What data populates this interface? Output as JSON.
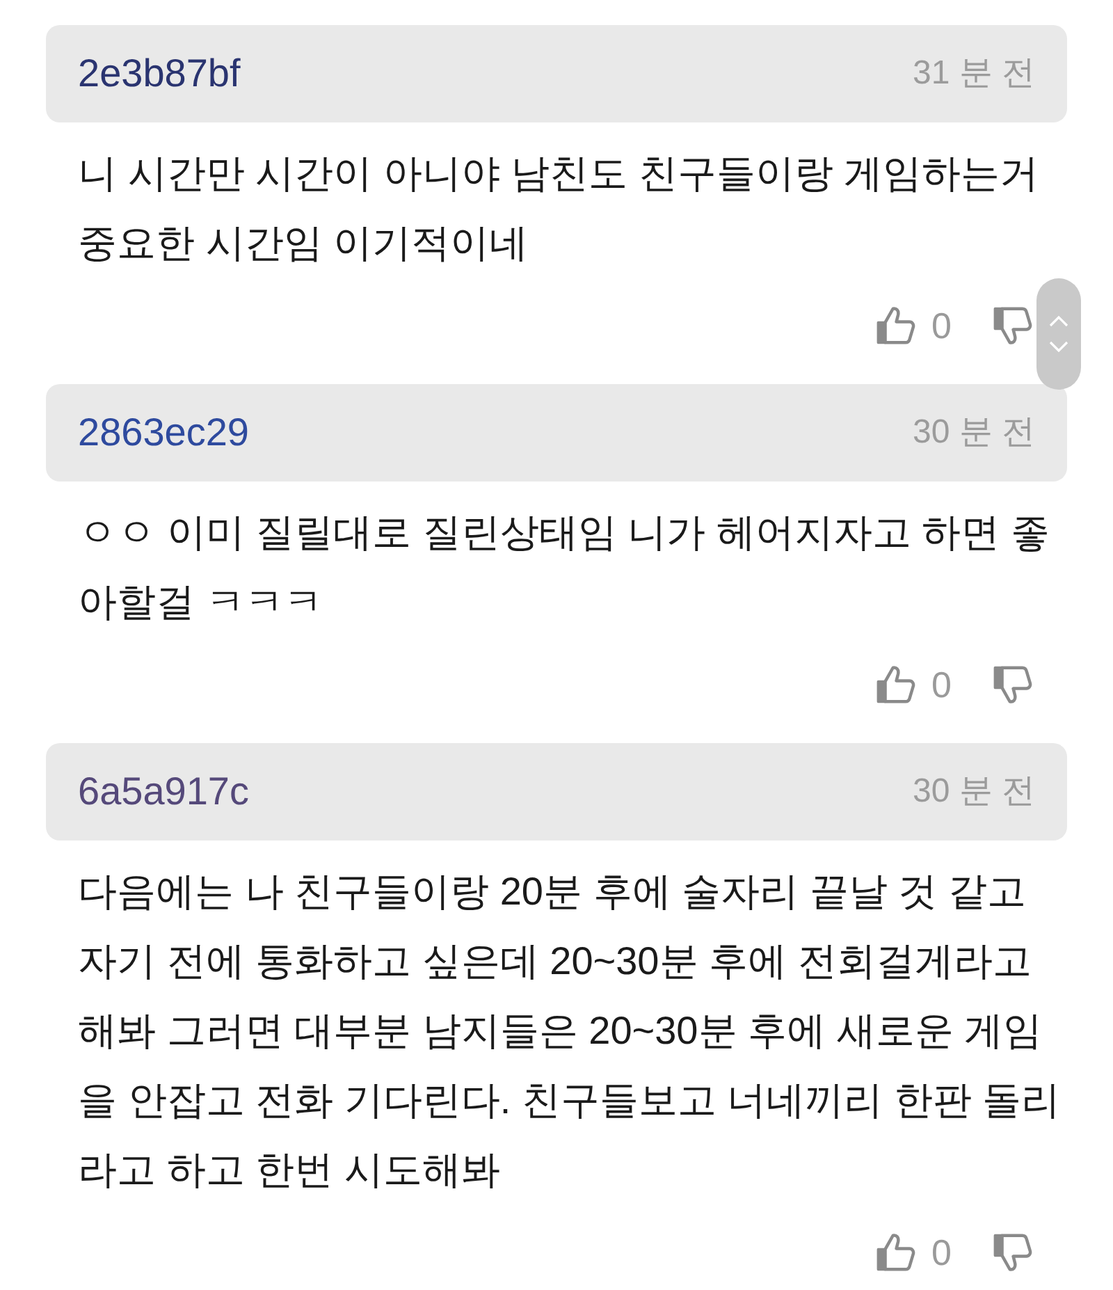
{
  "comments": [
    {
      "username": "2e3b87bf",
      "color": "#2a3470",
      "time": "31 분 전",
      "text": "니 시간만 시간이 아니야 남친도 친구들이랑 게임하는거 중요한 시간임 이기적이네",
      "likes": "0"
    },
    {
      "username": "2863ec29",
      "color": "#2e4a9e",
      "time": "30 분 전",
      "text": "ㅇㅇ 이미 질릴대로 질린상태임 니가 헤어지자고 하면 좋아할걸 ㅋㅋㅋ",
      "likes": "0"
    },
    {
      "username": "6a5a917c",
      "color": "#55497a",
      "time": "30 분 전",
      "text": "다음에는 나 친구들이랑 20분 후에 술자리 끝날 것 같고 자기 전에 통화하고 싶은데 20~30분 후에 전회걸게라고 해봐 그러면 대부분 남지들은 20~30분 후에 새로운 게임을 안잡고 전화 기다린다. 친구들보고 너네끼리 한판 돌리라고 하고 한번 시도해봐",
      "likes": "0"
    }
  ]
}
